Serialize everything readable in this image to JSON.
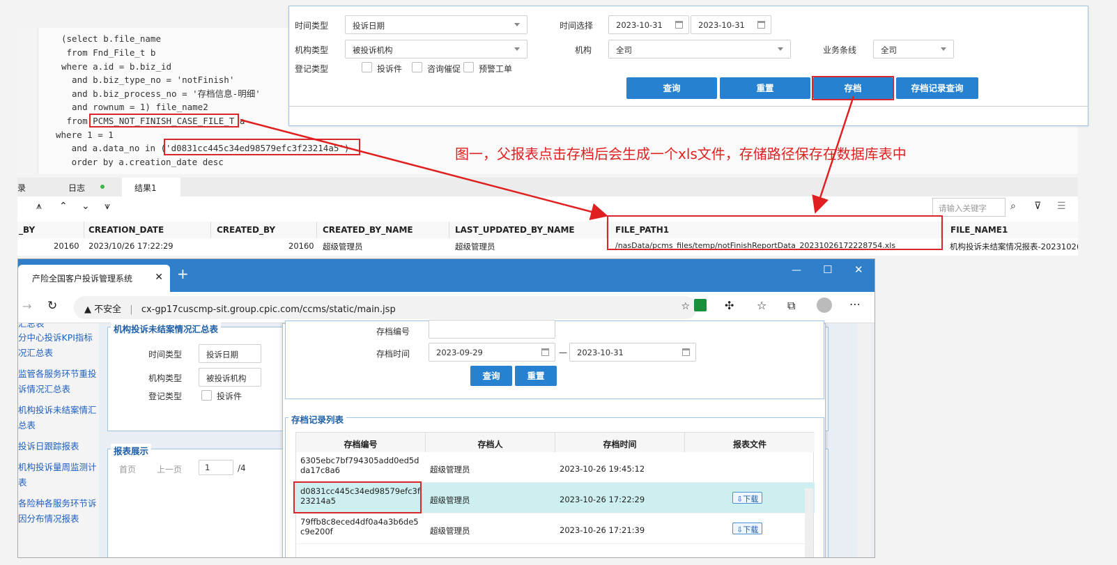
{
  "sql": {
    "lines": [
      "(select b.file_name",
      " from Fnd_File_t b",
      "where a.id = b.biz_id",
      "  and b.biz_type_no = 'notFinish'",
      "  and b.biz_process_no = '存档信息-明细'",
      "  and rownum = 1) file_name2",
      " from PCMS_NOT_FINISH_CASE_FILE_T a",
      "where 1 = 1",
      "   and a.data_no in ('d0831cc445c34ed98579efc3f23214a5')",
      "   order by a.creation_date desc"
    ]
  },
  "form": {
    "time_type_label": "时间类型",
    "time_type_value": "投诉日期",
    "time_select_label": "时间选择",
    "date_from": "2023-10-31",
    "date_to": "2023-10-31",
    "org_type_label": "机构类型",
    "org_type_value": "被投诉机构",
    "org_label": "机构",
    "org_value": "全司",
    "biz_line_label": "业务条线",
    "biz_line_value": "全司",
    "reg_type_label": "登记类型",
    "cb1": "投诉件",
    "cb2": "咨询催促",
    "cb3": "预警工单",
    "btn_query": "查询",
    "btn_reset": "重置",
    "btn_archive": "存档",
    "btn_archive_query": "存档记录查询"
  },
  "annotation": "图一，父报表点击存档后会生成一个xls文件，存储路径保存在数据库表中",
  "result": {
    "tab_prefix": "录",
    "tab_log": "日志",
    "tab_result": "结果1",
    "search_placeholder": "请输入关键字",
    "columns": [
      "_BY",
      "CREATION_DATE",
      "CREATED_BY",
      "CREATED_BY_NAME",
      "LAST_UPDATED_BY_NAME",
      "FILE_PATH1",
      "FILE_NAME1"
    ],
    "row": [
      "20160",
      "2023/10/26 17:22:29",
      "20160",
      "超级管理员",
      "超级管理员",
      "/nasData/pcms_files/temp/notFinishReportData_20231026172228754.xls",
      "机构投诉未结案情况报表-2023102("
    ]
  },
  "browser": {
    "tab_title": "产险全国客户投诉管理系统",
    "insecure": "不安全",
    "url": "cx-gp17cuscmp-sit.group.cpic.com/ccms/static/main.jsp",
    "side": [
      "汇总表",
      "分中心投诉KPI指标况汇总表",
      "监管各服务环节重投诉情况汇总表",
      "机构投诉未结案情汇总表",
      "投诉日跟踪报表",
      "机构投诉量周监测计表",
      "各险种各服务环节诉因分布情况报表"
    ],
    "fs1_legend": "机构投诉未结案情况汇总表",
    "fs1_time_type": "时间类型",
    "fs1_time_type_value": "投诉日期",
    "fs1_org_type": "机构类型",
    "fs1_org_type_value": "被投诉机构",
    "fs1_reg_type": "登记类型",
    "fs1_cb": "投诉件",
    "fs2_legend": "报表展示",
    "pager_first": "首页",
    "pager_prev": "上一页",
    "pager_page": "1",
    "pager_total": "/4",
    "popup_no_label": "存档编号",
    "popup_time_label": "存档时间",
    "popup_from": "2023-09-29",
    "popup_to": "2023-10-31",
    "popup_dash": "—",
    "popup_query": "查询",
    "popup_reset": "重置",
    "list_legend": "存档记录列表",
    "list_headers": [
      "存档编号",
      "存档人",
      "存档时间",
      "报表文件"
    ],
    "rows": [
      {
        "no": "6305ebc7bf794305add0ed5dda17c8a6",
        "user": "超级管理员",
        "time": "2023-10-26 19:45:12",
        "file": ""
      },
      {
        "no": "d0831cc445c34ed98579efc3f23214a5",
        "user": "超级管理员",
        "time": "2023-10-26 17:22:29",
        "file": "下载"
      },
      {
        "no": "79ffb8c8eced4df0a4a3b6de5c9e200f",
        "user": "超级管理员",
        "time": "2023-10-26 17:21:39",
        "file": "下载"
      }
    ]
  },
  "colors": {
    "accent": "#2682d0",
    "annot": "#d9262a"
  }
}
